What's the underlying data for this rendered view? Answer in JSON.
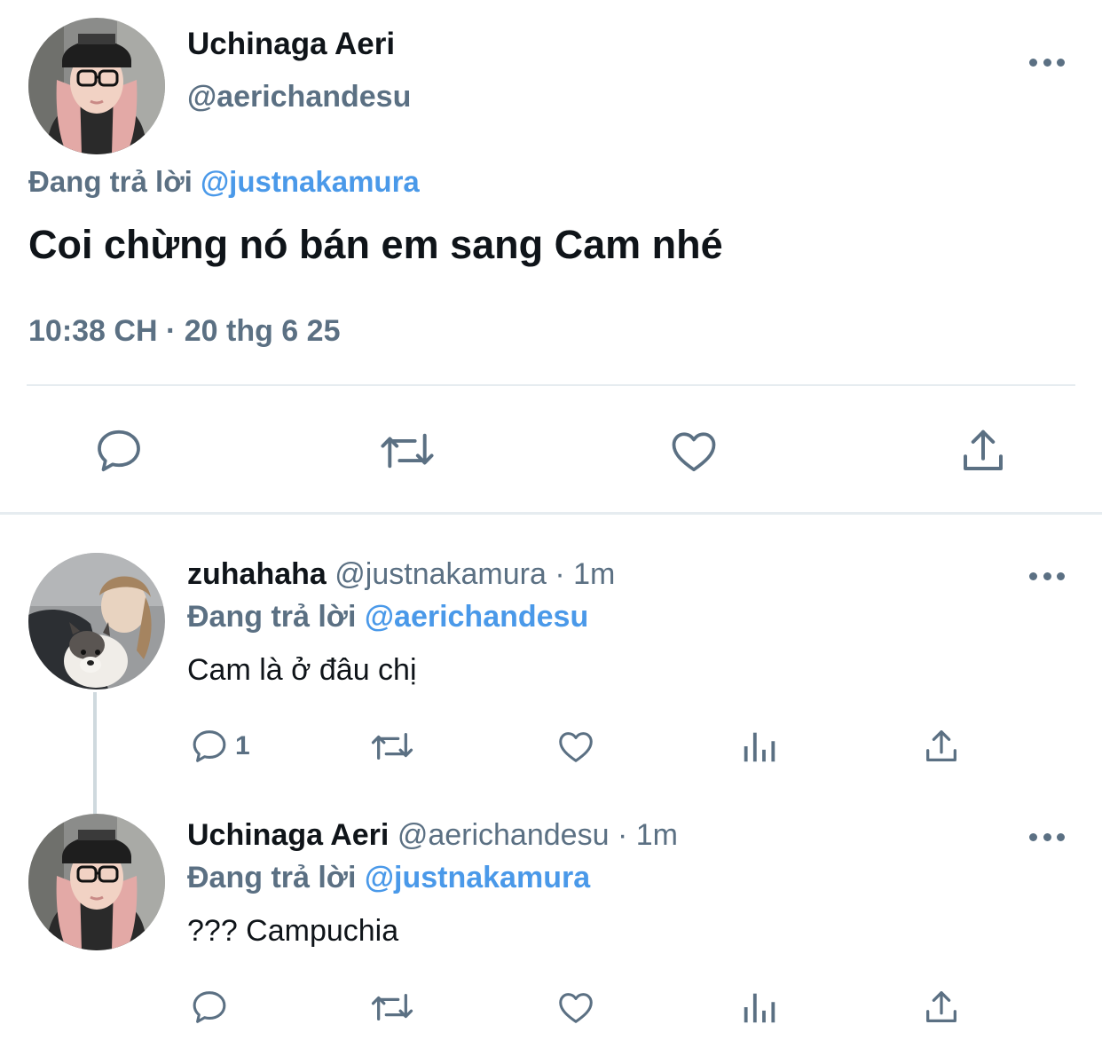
{
  "main_tweet": {
    "author_name": "Uchinaga Aeri",
    "author_handle": "@aerichandesu",
    "replying_prefix": "Đang trả lời",
    "replying_to": "@justnakamura",
    "text": "Coi chừng nó bán em sang Cam nhé",
    "time": "10:38 CH · 20 thg 6 25",
    "actions": [
      "reply-icon",
      "retweet-icon",
      "like-icon",
      "share-icon"
    ]
  },
  "replies": [
    {
      "author_name": "zuhahaha",
      "author_handle": "@justnakamura",
      "time": "· 1m",
      "replying_prefix": "Đang trả lời",
      "replying_to": "@aerichandesu",
      "text": "Cam là ở đâu chị",
      "reply_count": "1"
    },
    {
      "author_name": "Uchinaga Aeri",
      "author_handle": "@aerichandesu",
      "time": "· 1m",
      "replying_prefix": "Đang trả lời",
      "replying_to": "@justnakamura",
      "text": "??? Campuchia",
      "reply_count": ""
    }
  ],
  "colors": {
    "text_primary": "#0f1419",
    "text_secondary": "#5b7083",
    "link": "#4a99e9",
    "divider": "#e6ecf0"
  }
}
